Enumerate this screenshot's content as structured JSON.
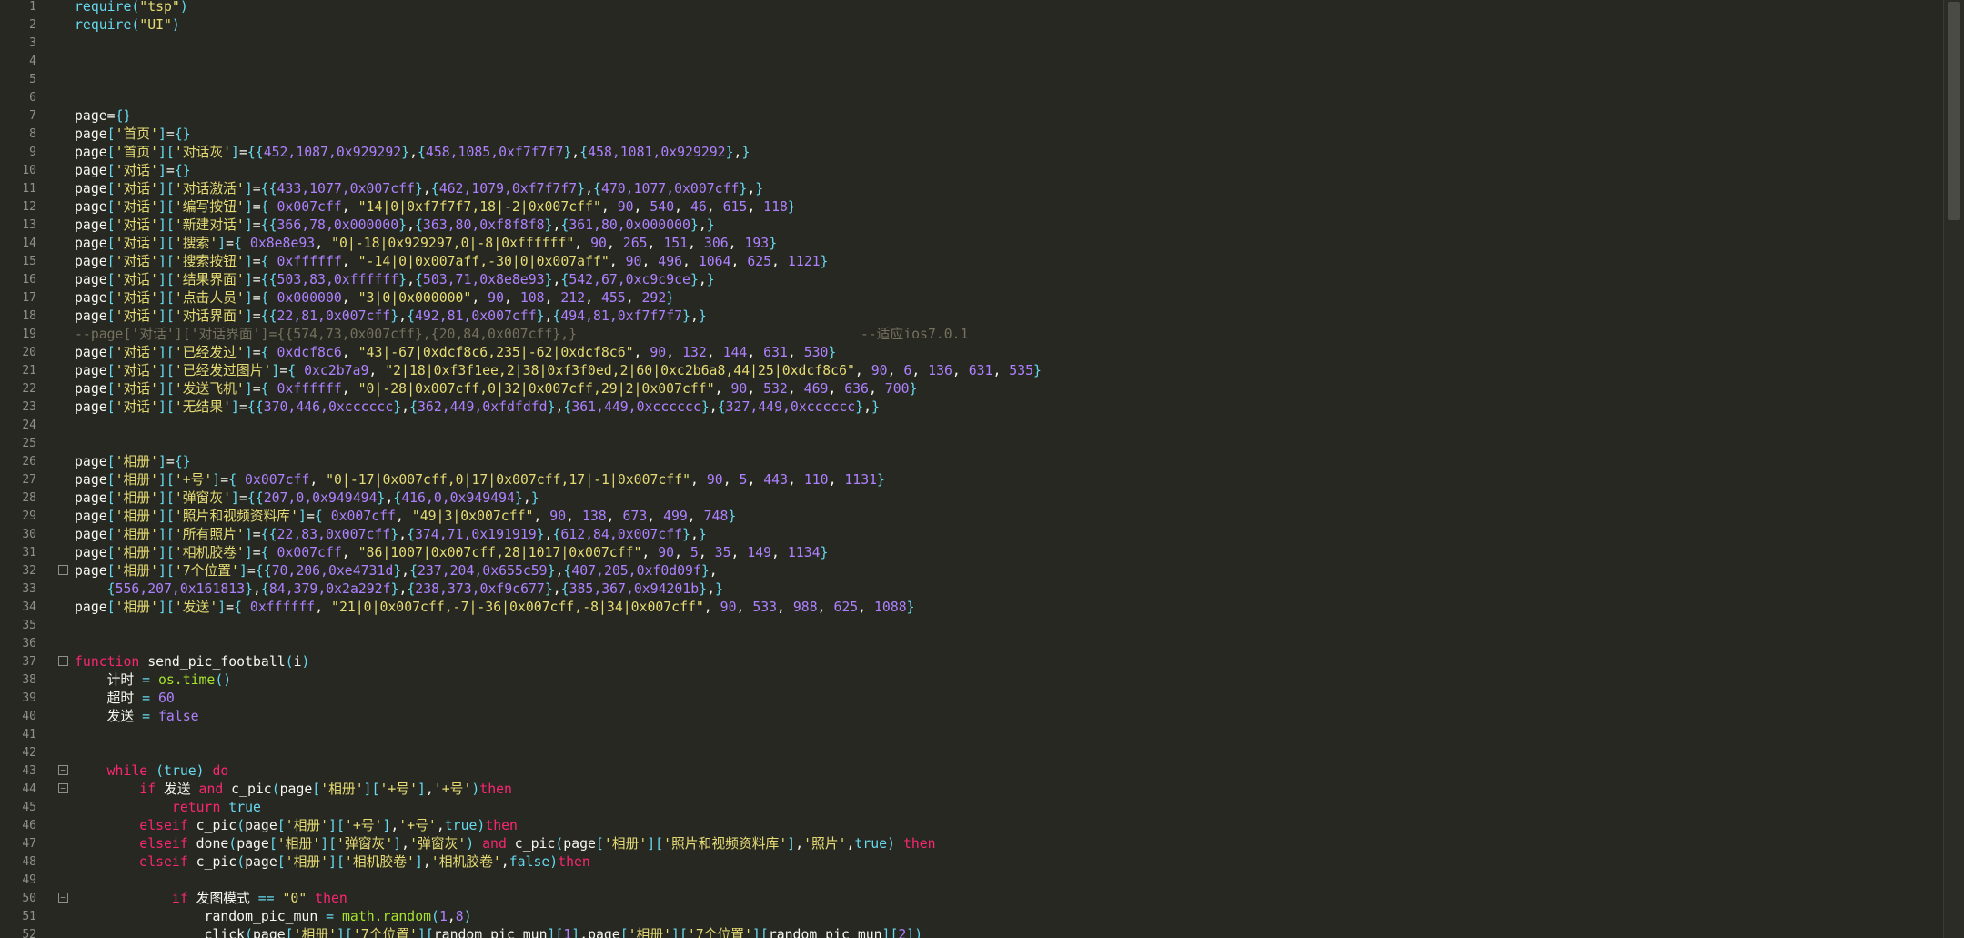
{
  "editor": {
    "lines": [
      {
        "n": "1",
        "fold": "",
        "html": "<span class=\"kw2\">require</span><span class=\"br\">(</span><span class=\"str\">\"tsp\"</span><span class=\"br\">)</span>"
      },
      {
        "n": "2",
        "fold": "",
        "html": "<span class=\"kw2\">require</span><span class=\"br\">(</span><span class=\"str\">\"UI\"</span><span class=\"br\">)</span>"
      },
      {
        "n": "3",
        "fold": "",
        "html": ""
      },
      {
        "n": "4",
        "fold": "",
        "html": ""
      },
      {
        "n": "5",
        "fold": "",
        "html": ""
      },
      {
        "n": "6",
        "fold": "",
        "html": ""
      },
      {
        "n": "7",
        "fold": "",
        "html": "page<span class=\"op\">=</span><span class=\"br\">{}</span>"
      },
      {
        "n": "8",
        "fold": "",
        "html": "page<span class=\"br\">[</span><span class=\"str\">'首页'</span><span class=\"br\">]</span>=<span class=\"br\">{}</span>"
      },
      {
        "n": "9",
        "fold": "",
        "html": "page<span class=\"br\">[</span><span class=\"str\">'首页'</span><span class=\"br\">][</span><span class=\"str\">'对话灰'</span><span class=\"br\">]</span>=<span class=\"br\">{{</span><span class=\"num\">452,1087,0x929292</span><span class=\"br\">}</span>,<span class=\"br\">{</span><span class=\"num\">458,1085,0xf7f7f7</span><span class=\"br\">}</span>,<span class=\"br\">{</span><span class=\"num\">458,1081,0x929292</span><span class=\"br\">}</span>,<span class=\"br\">}</span>"
      },
      {
        "n": "10",
        "fold": "",
        "html": "page<span class=\"br\">[</span><span class=\"str\">'对话'</span><span class=\"br\">]</span>=<span class=\"br\">{}</span>"
      },
      {
        "n": "11",
        "fold": "",
        "html": "page<span class=\"br\">[</span><span class=\"str\">'对话'</span><span class=\"br\">][</span><span class=\"str\">'对话激活'</span><span class=\"br\">]</span>=<span class=\"br\">{{</span><span class=\"num\">433,1077,0x007cff</span><span class=\"br\">}</span>,<span class=\"br\">{</span><span class=\"num\">462,1079,0xf7f7f7</span><span class=\"br\">}</span>,<span class=\"br\">{</span><span class=\"num\">470,1077,0x007cff</span><span class=\"br\">}</span>,<span class=\"br\">}</span>"
      },
      {
        "n": "12",
        "fold": "",
        "html": "page<span class=\"br\">[</span><span class=\"str\">'对话'</span><span class=\"br\">][</span><span class=\"str\">'编写按钮'</span><span class=\"br\">]</span>=<span class=\"br\">{</span> <span class=\"num\">0x007cff</span>, <span class=\"str\">\"14|0|0xf7f7f7,18|-2|0x007cff\"</span>, <span class=\"num\">90</span>, <span class=\"num\">540</span>, <span class=\"num\">46</span>, <span class=\"num\">615</span>, <span class=\"num\">118</span><span class=\"br\">}</span>"
      },
      {
        "n": "13",
        "fold": "",
        "html": "page<span class=\"br\">[</span><span class=\"str\">'对话'</span><span class=\"br\">][</span><span class=\"str\">'新建对话'</span><span class=\"br\">]</span>=<span class=\"br\">{{</span><span class=\"num\">366,78,0x000000</span><span class=\"br\">}</span>,<span class=\"br\">{</span><span class=\"num\">363,80,0xf8f8f8</span><span class=\"br\">}</span>,<span class=\"br\">{</span><span class=\"num\">361,80,0x000000</span><span class=\"br\">}</span>,<span class=\"br\">}</span>"
      },
      {
        "n": "14",
        "fold": "",
        "html": "page<span class=\"br\">[</span><span class=\"str\">'对话'</span><span class=\"br\">][</span><span class=\"str\">'搜索'</span><span class=\"br\">]</span>=<span class=\"br\">{</span> <span class=\"num\">0x8e8e93</span>, <span class=\"str\">\"0|-18|0x929297,0|-8|0xffffff\"</span>, <span class=\"num\">90</span>, <span class=\"num\">265</span>, <span class=\"num\">151</span>, <span class=\"num\">306</span>, <span class=\"num\">193</span><span class=\"br\">}</span>"
      },
      {
        "n": "15",
        "fold": "",
        "html": "page<span class=\"br\">[</span><span class=\"str\">'对话'</span><span class=\"br\">][</span><span class=\"str\">'搜索按钮'</span><span class=\"br\">]</span>=<span class=\"br\">{</span> <span class=\"num\">0xffffff</span>, <span class=\"str\">\"-14|0|0x007aff,-30|0|0x007aff\"</span>, <span class=\"num\">90</span>, <span class=\"num\">496</span>, <span class=\"num\">1064</span>, <span class=\"num\">625</span>, <span class=\"num\">1121</span><span class=\"br\">}</span>"
      },
      {
        "n": "16",
        "fold": "",
        "html": "page<span class=\"br\">[</span><span class=\"str\">'对话'</span><span class=\"br\">][</span><span class=\"str\">'结果界面'</span><span class=\"br\">]</span>=<span class=\"br\">{{</span><span class=\"num\">503,83,0xffffff</span><span class=\"br\">}</span>,<span class=\"br\">{</span><span class=\"num\">503,71,0x8e8e93</span><span class=\"br\">}</span>,<span class=\"br\">{</span><span class=\"num\">542,67,0xc9c9ce</span><span class=\"br\">}</span>,<span class=\"br\">}</span>"
      },
      {
        "n": "17",
        "fold": "",
        "html": "page<span class=\"br\">[</span><span class=\"str\">'对话'</span><span class=\"br\">][</span><span class=\"str\">'点击人员'</span><span class=\"br\">]</span>=<span class=\"br\">{</span> <span class=\"num\">0x000000</span>, <span class=\"str\">\"3|0|0x000000\"</span>, <span class=\"num\">90</span>, <span class=\"num\">108</span>, <span class=\"num\">212</span>, <span class=\"num\">455</span>, <span class=\"num\">292</span><span class=\"br\">}</span>"
      },
      {
        "n": "18",
        "fold": "",
        "html": "page<span class=\"br\">[</span><span class=\"str\">'对话'</span><span class=\"br\">][</span><span class=\"str\">'对话界面'</span><span class=\"br\">]</span>=<span class=\"br\">{{</span><span class=\"num\">22,81,0x007cff</span><span class=\"br\">}</span>,<span class=\"br\">{</span><span class=\"num\">492,81,0x007cff</span><span class=\"br\">}</span>,<span class=\"br\">{</span><span class=\"num\">494,81,0xf7f7f7</span><span class=\"br\">}</span>,<span class=\"br\">}</span>"
      },
      {
        "n": "19",
        "fold": "",
        "html": "<span class=\"com\">--page['对话']['对话界面']={{574,73,0x007cff},{20,84,0x007cff},}                                   --适应ios7.0.1</span>"
      },
      {
        "n": "20",
        "fold": "",
        "html": "page<span class=\"br\">[</span><span class=\"str\">'对话'</span><span class=\"br\">][</span><span class=\"str\">'已经发过'</span><span class=\"br\">]</span>=<span class=\"br\">{</span> <span class=\"num\">0xdcf8c6</span>, <span class=\"str\">\"43|-67|0xdcf8c6,235|-62|0xdcf8c6\"</span>, <span class=\"num\">90</span>, <span class=\"num\">132</span>, <span class=\"num\">144</span>, <span class=\"num\">631</span>, <span class=\"num\">530</span><span class=\"br\">}</span>"
      },
      {
        "n": "21",
        "fold": "",
        "html": "page<span class=\"br\">[</span><span class=\"str\">'对话'</span><span class=\"br\">][</span><span class=\"str\">'已经发过图片'</span><span class=\"br\">]</span>=<span class=\"br\">{</span> <span class=\"num\">0xc2b7a9</span>, <span class=\"str\">\"2|18|0xf3f1ee,2|38|0xf3f0ed,2|60|0xc2b6a8,44|25|0xdcf8c6\"</span>, <span class=\"num\">90</span>, <span class=\"num\">6</span>, <span class=\"num\">136</span>, <span class=\"num\">631</span>, <span class=\"num\">535</span><span class=\"br\">}</span>"
      },
      {
        "n": "22",
        "fold": "",
        "html": "page<span class=\"br\">[</span><span class=\"str\">'对话'</span><span class=\"br\">][</span><span class=\"str\">'发送飞机'</span><span class=\"br\">]</span>=<span class=\"br\">{</span> <span class=\"num\">0xffffff</span>, <span class=\"str\">\"0|-28|0x007cff,0|32|0x007cff,29|2|0x007cff\"</span>, <span class=\"num\">90</span>, <span class=\"num\">532</span>, <span class=\"num\">469</span>, <span class=\"num\">636</span>, <span class=\"num\">700</span><span class=\"br\">}</span>"
      },
      {
        "n": "23",
        "fold": "",
        "html": "page<span class=\"br\">[</span><span class=\"str\">'对话'</span><span class=\"br\">][</span><span class=\"str\">'无结果'</span><span class=\"br\">]</span>=<span class=\"br\">{{</span><span class=\"num\">370,446,0xcccccc</span><span class=\"br\">}</span>,<span class=\"br\">{</span><span class=\"num\">362,449,0xfdfdfd</span><span class=\"br\">}</span>,<span class=\"br\">{</span><span class=\"num\">361,449,0xcccccc</span><span class=\"br\">}</span>,<span class=\"br\">{</span><span class=\"num\">327,449,0xcccccc</span><span class=\"br\">}</span>,<span class=\"br\">}</span>"
      },
      {
        "n": "24",
        "fold": "",
        "html": ""
      },
      {
        "n": "25",
        "fold": "",
        "html": ""
      },
      {
        "n": "26",
        "fold": "",
        "html": "page<span class=\"br\">[</span><span class=\"str\">'相册'</span><span class=\"br\">]</span>=<span class=\"br\">{}</span>"
      },
      {
        "n": "27",
        "fold": "",
        "html": "page<span class=\"br\">[</span><span class=\"str\">'相册'</span><span class=\"br\">][</span><span class=\"str\">'+号'</span><span class=\"br\">]</span>=<span class=\"br\">{</span> <span class=\"num\">0x007cff</span>, <span class=\"str\">\"0|-17|0x007cff,0|17|0x007cff,17|-1|0x007cff\"</span>, <span class=\"num\">90</span>, <span class=\"num\">5</span>, <span class=\"num\">443</span>, <span class=\"num\">110</span>, <span class=\"num\">1131</span><span class=\"br\">}</span>"
      },
      {
        "n": "28",
        "fold": "",
        "html": "page<span class=\"br\">[</span><span class=\"str\">'相册'</span><span class=\"br\">][</span><span class=\"str\">'弹窗灰'</span><span class=\"br\">]</span>=<span class=\"br\">{{</span><span class=\"num\">207,0,0x949494</span><span class=\"br\">}</span>,<span class=\"br\">{</span><span class=\"num\">416,0,0x949494</span><span class=\"br\">}</span>,<span class=\"br\">}</span>"
      },
      {
        "n": "29",
        "fold": "",
        "html": "page<span class=\"br\">[</span><span class=\"str\">'相册'</span><span class=\"br\">][</span><span class=\"str\">'照片和视频资料库'</span><span class=\"br\">]</span>=<span class=\"br\">{</span> <span class=\"num\">0x007cff</span>, <span class=\"str\">\"49|3|0x007cff\"</span>, <span class=\"num\">90</span>, <span class=\"num\">138</span>, <span class=\"num\">673</span>, <span class=\"num\">499</span>, <span class=\"num\">748</span><span class=\"br\">}</span>"
      },
      {
        "n": "30",
        "fold": "",
        "html": "page<span class=\"br\">[</span><span class=\"str\">'相册'</span><span class=\"br\">][</span><span class=\"str\">'所有照片'</span><span class=\"br\">]</span>=<span class=\"br\">{{</span><span class=\"num\">22,83,0x007cff</span><span class=\"br\">}</span>,<span class=\"br\">{</span><span class=\"num\">374,71,0x191919</span><span class=\"br\">}</span>,<span class=\"br\">{</span><span class=\"num\">612,84,0x007cff</span><span class=\"br\">}</span>,<span class=\"br\">}</span>"
      },
      {
        "n": "31",
        "fold": "",
        "html": "page<span class=\"br\">[</span><span class=\"str\">'相册'</span><span class=\"br\">][</span><span class=\"str\">'相机胶卷'</span><span class=\"br\">]</span>=<span class=\"br\">{</span> <span class=\"num\">0x007cff</span>, <span class=\"str\">\"86|1007|0x007cff,28|1017|0x007cff\"</span>, <span class=\"num\">90</span>, <span class=\"num\">5</span>, <span class=\"num\">35</span>, <span class=\"num\">149</span>, <span class=\"num\">1134</span><span class=\"br\">}</span>"
      },
      {
        "n": "32",
        "fold": "minus",
        "html": "page<span class=\"br\">[</span><span class=\"str\">'相册'</span><span class=\"br\">][</span><span class=\"str\">'7个位置'</span><span class=\"br\">]</span>=<span class=\"br\">{{</span><span class=\"num\">70,206,0xe4731d</span><span class=\"br\">}</span>,<span class=\"br\">{</span><span class=\"num\">237,204,0x655c59</span><span class=\"br\">}</span>,<span class=\"br\">{</span><span class=\"num\">407,205,0xf0d09f</span><span class=\"br\">}</span>,"
      },
      {
        "n": "33",
        "fold": "",
        "html": "    <span class=\"br\">{</span><span class=\"num\">556,207,0x161813</span><span class=\"br\">}</span>,<span class=\"br\">{</span><span class=\"num\">84,379,0x2a292f</span><span class=\"br\">}</span>,<span class=\"br\">{</span><span class=\"num\">238,373,0xf9c677</span><span class=\"br\">}</span>,<span class=\"br\">{</span><span class=\"num\">385,367,0x94201b</span><span class=\"br\">}</span>,<span class=\"br\">}</span>"
      },
      {
        "n": "34",
        "fold": "",
        "html": "page<span class=\"br\">[</span><span class=\"str\">'相册'</span><span class=\"br\">][</span><span class=\"str\">'发送'</span><span class=\"br\">]</span>=<span class=\"br\">{</span> <span class=\"num\">0xffffff</span>, <span class=\"str\">\"21|0|0x007cff,-7|-36|0x007cff,-8|34|0x007cff\"</span>, <span class=\"num\">90</span>, <span class=\"num\">533</span>, <span class=\"num\">988</span>, <span class=\"num\">625</span>, <span class=\"num\">1088</span><span class=\"br\">}</span>"
      },
      {
        "n": "35",
        "fold": "",
        "html": ""
      },
      {
        "n": "36",
        "fold": "",
        "html": ""
      },
      {
        "n": "37",
        "fold": "minus",
        "html": "<span class=\"kw\">function</span> send_pic_football<span class=\"br\">(</span>i<span class=\"br\">)</span>"
      },
      {
        "n": "38",
        "fold": "",
        "html": "    计时 <span class=\"kw2\">=</span> <span class=\"fn\">os.time</span><span class=\"br\">()</span>"
      },
      {
        "n": "39",
        "fold": "",
        "html": "    超时 <span class=\"kw2\">=</span> <span class=\"num\">60</span>"
      },
      {
        "n": "40",
        "fold": "",
        "html": "    发送 <span class=\"kw2\">=</span> <span class=\"num\">false</span>"
      },
      {
        "n": "41",
        "fold": "",
        "html": ""
      },
      {
        "n": "42",
        "fold": "",
        "html": ""
      },
      {
        "n": "43",
        "fold": "minus",
        "html": "    <span class=\"kw\">while</span> <span class=\"br\">(</span><span class=\"kw2\">true</span><span class=\"br\">)</span> <span class=\"kw\">do</span>"
      },
      {
        "n": "44",
        "fold": "minus",
        "html": "        <span class=\"kw\">if</span> 发送 <span class=\"kw\">and</span> c_pic<span class=\"br\">(</span>page<span class=\"br\">[</span><span class=\"str\">'相册'</span><span class=\"br\">][</span><span class=\"str\">'+号'</span><span class=\"br\">]</span>,<span class=\"str\">'+号'</span><span class=\"br\">)</span><span class=\"kw\">then</span>"
      },
      {
        "n": "45",
        "fold": "",
        "html": "            <span class=\"kw\">return</span> <span class=\"kw2\">true</span>"
      },
      {
        "n": "46",
        "fold": "",
        "html": "        <span class=\"kw\">elseif</span> c_pic<span class=\"br\">(</span>page<span class=\"br\">[</span><span class=\"str\">'相册'</span><span class=\"br\">][</span><span class=\"str\">'+号'</span><span class=\"br\">]</span>,<span class=\"str\">'+号'</span>,<span class=\"kw2\">true</span><span class=\"br\">)</span><span class=\"kw\">then</span>"
      },
      {
        "n": "47",
        "fold": "",
        "html": "        <span class=\"kw\">elseif</span> done<span class=\"br\">(</span>page<span class=\"br\">[</span><span class=\"str\">'相册'</span><span class=\"br\">][</span><span class=\"str\">'弹窗灰'</span><span class=\"br\">]</span>,<span class=\"str\">'弹窗灰'</span><span class=\"br\">)</span> <span class=\"kw\">and</span> c_pic<span class=\"br\">(</span>page<span class=\"br\">[</span><span class=\"str\">'相册'</span><span class=\"br\">][</span><span class=\"str\">'照片和视频资料库'</span><span class=\"br\">]</span>,<span class=\"str\">'照片'</span>,<span class=\"kw2\">true</span><span class=\"br\">)</span> <span class=\"kw\">then</span>"
      },
      {
        "n": "48",
        "fold": "",
        "html": "        <span class=\"kw\">elseif</span> c_pic<span class=\"br\">(</span>page<span class=\"br\">[</span><span class=\"str\">'相册'</span><span class=\"br\">][</span><span class=\"str\">'相机胶卷'</span><span class=\"br\">]</span>,<span class=\"str\">'相机胶卷'</span>,<span class=\"kw2\">false</span><span class=\"br\">)</span><span class=\"kw\">then</span>"
      },
      {
        "n": "49",
        "fold": "",
        "html": ""
      },
      {
        "n": "50",
        "fold": "minus",
        "html": "            <span class=\"kw\">if</span> 发图模式 <span class=\"kw2\">==</span> <span class=\"str\">\"0\"</span> <span class=\"kw\">then</span>"
      },
      {
        "n": "51",
        "fold": "",
        "html": "                random_pic_mun <span class=\"kw2\">=</span> <span class=\"fn\">math.random</span><span class=\"br\">(</span><span class=\"num\">1</span>,<span class=\"num\">8</span><span class=\"br\">)</span>"
      },
      {
        "n": "52",
        "fold": "",
        "html": "                click<span class=\"br\">(</span>page<span class=\"br\">[</span><span class=\"str\">'相册'</span><span class=\"br\">][</span><span class=\"str\">'7个位置'</span><span class=\"br\">][</span>random_pic_mun<span class=\"br\">][</span><span class=\"num\">1</span><span class=\"br\">]</span>,page<span class=\"br\">[</span><span class=\"str\">'相册'</span><span class=\"br\">][</span><span class=\"str\">'7个位置'</span><span class=\"br\">][</span>random_pic_mun<span class=\"br\">][</span><span class=\"num\">2</span><span class=\"br\">])</span>"
      }
    ]
  }
}
